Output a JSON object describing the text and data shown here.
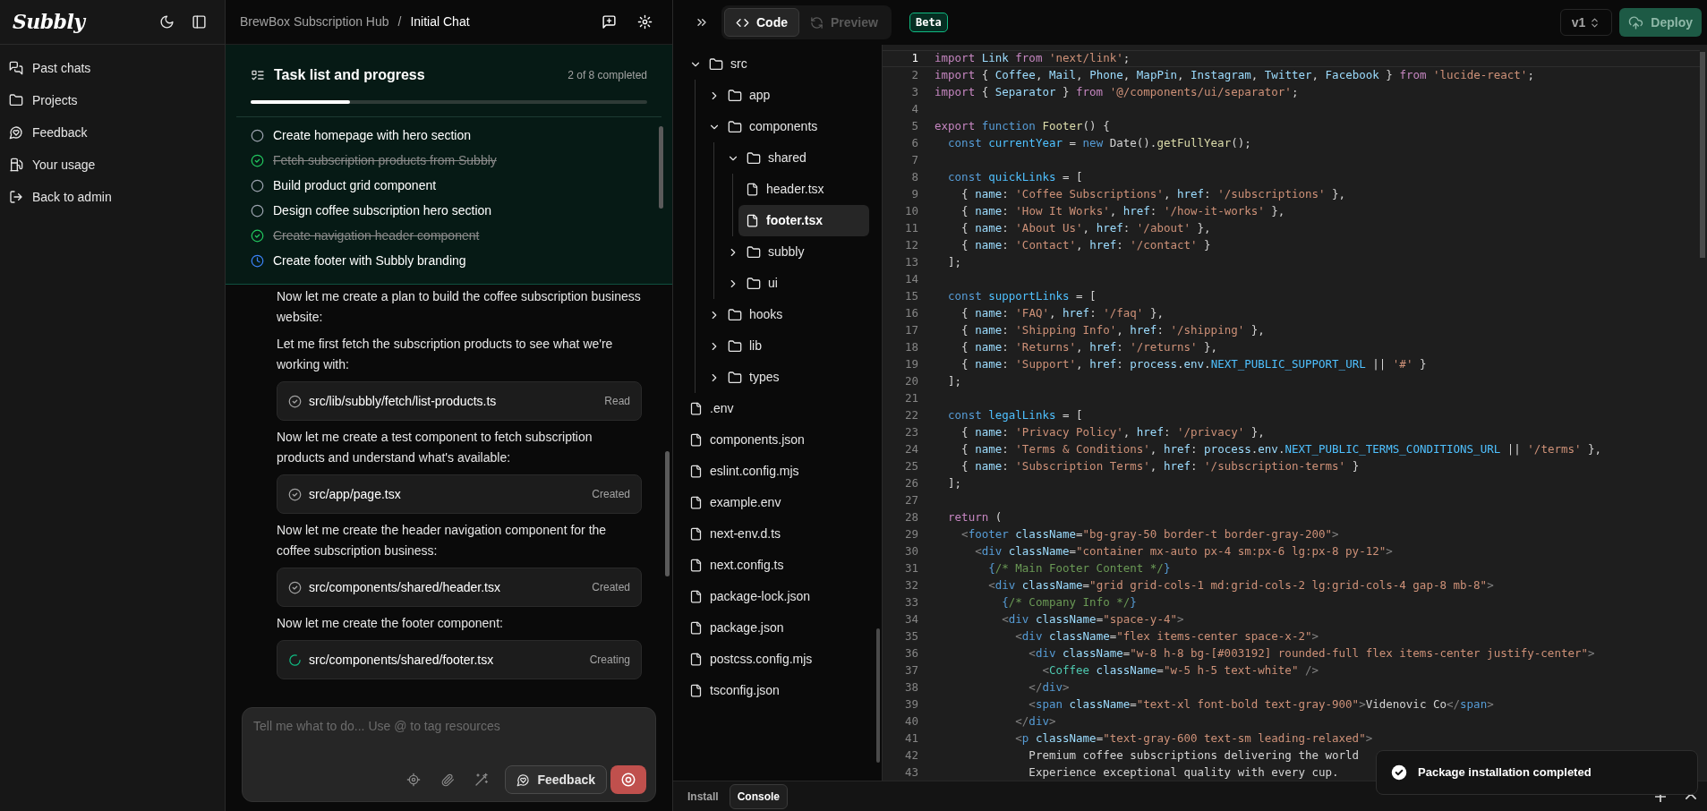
{
  "sidebar": {
    "logo": "Subbly",
    "items": [
      {
        "label": "Past chats"
      },
      {
        "label": "Projects"
      },
      {
        "label": "Feedback"
      },
      {
        "label": "Your usage"
      },
      {
        "label": "Back to admin"
      }
    ]
  },
  "chat": {
    "breadcrumb": {
      "project": "BrewBox Subscription Hub",
      "separator": "/",
      "chat": "Initial Chat"
    },
    "tasks": {
      "title": "Task list and progress",
      "count": "2 of 8 completed",
      "level": 0.25,
      "items": [
        {
          "label": "Create homepage with hero section",
          "checked": false,
          "in_progress": false
        },
        {
          "label": "Fetch subscription products from Subbly",
          "checked": true,
          "in_progress": false
        },
        {
          "label": "Build product grid component",
          "checked": false,
          "in_progress": false
        },
        {
          "label": "Design coffee subscription hero section",
          "checked": false,
          "in_progress": false
        },
        {
          "label": "Create navigation header component",
          "checked": true,
          "in_progress": false
        },
        {
          "label": "Create footer with Subbly branding",
          "checked": false,
          "in_progress": true
        }
      ]
    },
    "messages": [
      {
        "kind": "text",
        "text": "Now let me create a plan to build the coffee subscription business website:"
      },
      {
        "kind": "text",
        "text": "Let me first fetch the subscription products to see what we're working with:"
      },
      {
        "kind": "file",
        "path": "src/lib/subbly/fetch/list-products.ts",
        "status": "Read",
        "running": false
      },
      {
        "kind": "text",
        "text": "Now let me create a test component to fetch subscription products and understand what's available:"
      },
      {
        "kind": "file",
        "path": "src/app/page.tsx",
        "status": "Created",
        "running": false
      },
      {
        "kind": "text",
        "text": "Now let me create the header navigation component for the coffee subscription business:"
      },
      {
        "kind": "file",
        "path": "src/components/shared/header.tsx",
        "status": "Created",
        "running": false
      },
      {
        "kind": "text",
        "text": "Now let me create the footer component:"
      },
      {
        "kind": "file",
        "path": "src/components/shared/footer.tsx",
        "status": "Creating",
        "running": true
      }
    ],
    "input": {
      "placeholder": "Tell me what to do... Use @ to tag resources",
      "feedback": "Feedback"
    }
  },
  "toolbar": {
    "tabs": [
      {
        "label": "Code",
        "selected": true
      },
      {
        "label": "Preview",
        "selected": false
      }
    ],
    "badge": "Beta",
    "version": "v1",
    "deploy": "Deploy"
  },
  "file_tree": [
    {
      "name": "src",
      "kind": "folder",
      "expanded": true,
      "selected": false,
      "children": [
        {
          "name": "app",
          "kind": "folder",
          "expanded": false,
          "selected": false
        },
        {
          "name": "components",
          "kind": "folder",
          "expanded": true,
          "selected": false,
          "children": [
            {
              "name": "shared",
              "kind": "folder",
              "expanded": true,
              "selected": false,
              "children": [
                {
                  "name": "header.tsx",
                  "kind": "file",
                  "selected": false
                },
                {
                  "name": "footer.tsx",
                  "kind": "file",
                  "selected": true
                }
              ]
            },
            {
              "name": "subbly",
              "kind": "folder",
              "expanded": false,
              "selected": false
            },
            {
              "name": "ui",
              "kind": "folder",
              "expanded": false,
              "selected": false
            }
          ]
        },
        {
          "name": "hooks",
          "kind": "folder",
          "expanded": false,
          "selected": false
        },
        {
          "name": "lib",
          "kind": "folder",
          "expanded": false,
          "selected": false
        },
        {
          "name": "types",
          "kind": "folder",
          "expanded": false,
          "selected": false
        }
      ]
    },
    {
      "name": ".env",
      "kind": "file",
      "selected": false
    },
    {
      "name": "components.json",
      "kind": "file",
      "selected": false
    },
    {
      "name": "eslint.config.mjs",
      "kind": "file",
      "selected": false
    },
    {
      "name": "example.env",
      "kind": "file",
      "selected": false
    },
    {
      "name": "next-env.d.ts",
      "kind": "file",
      "selected": false
    },
    {
      "name": "next.config.ts",
      "kind": "file",
      "selected": false
    },
    {
      "name": "package-lock.json",
      "kind": "file",
      "selected": false
    },
    {
      "name": "package.json",
      "kind": "file",
      "selected": false
    },
    {
      "name": "postcss.config.mjs",
      "kind": "file",
      "selected": false
    },
    {
      "name": "tsconfig.json",
      "kind": "file",
      "selected": false
    }
  ],
  "editor": {
    "lines": [
      {
        "number": "1",
        "current": true,
        "segments": [
          {
            "kind": "keyword",
            "text": "import"
          },
          {
            "kind": "variable",
            "text": " Link"
          },
          {
            "kind": "keyword",
            "text": " from"
          },
          {
            "kind": "string",
            "text": " 'next/link'"
          },
          {
            "kind": "plain",
            "text": ";"
          }
        ]
      },
      {
        "number": "2",
        "current": false,
        "segments": [
          {
            "kind": "keyword",
            "text": "import"
          },
          {
            "kind": "plain",
            "text": " { "
          },
          {
            "kind": "variable",
            "text": "Coffee"
          },
          {
            "kind": "plain",
            "text": ", "
          },
          {
            "kind": "variable",
            "text": "Mail"
          },
          {
            "kind": "plain",
            "text": ", "
          },
          {
            "kind": "variable",
            "text": "Phone"
          },
          {
            "kind": "plain",
            "text": ", "
          },
          {
            "kind": "variable",
            "text": "MapPin"
          },
          {
            "kind": "plain",
            "text": ", "
          },
          {
            "kind": "variable",
            "text": "Instagram"
          },
          {
            "kind": "plain",
            "text": ", "
          },
          {
            "kind": "variable",
            "text": "Twitter"
          },
          {
            "kind": "plain",
            "text": ", "
          },
          {
            "kind": "variable",
            "text": "Facebook"
          },
          {
            "kind": "plain",
            "text": " } "
          },
          {
            "kind": "keyword",
            "text": "from"
          },
          {
            "kind": "string",
            "text": " 'lucide-react'"
          },
          {
            "kind": "plain",
            "text": ";"
          }
        ]
      },
      {
        "number": "3",
        "current": false,
        "segments": [
          {
            "kind": "keyword",
            "text": "import"
          },
          {
            "kind": "plain",
            "text": " { "
          },
          {
            "kind": "variable",
            "text": "Separator"
          },
          {
            "kind": "plain",
            "text": " } "
          },
          {
            "kind": "keyword",
            "text": "from"
          },
          {
            "kind": "string",
            "text": " '@/components/ui/separator'"
          },
          {
            "kind": "plain",
            "text": ";"
          }
        ]
      },
      {
        "number": "4",
        "current": false
      },
      {
        "number": "5",
        "current": false,
        "segments": [
          {
            "kind": "keyword",
            "text": "export"
          },
          {
            "kind": "storage",
            "text": " function"
          },
          {
            "kind": "function",
            "text": " Footer"
          },
          {
            "kind": "plain",
            "text": "() {"
          }
        ]
      },
      {
        "number": "6",
        "current": false,
        "segments": [
          {
            "kind": "storage",
            "text": "  const"
          },
          {
            "kind": "constant",
            "text": " currentYear"
          },
          {
            "kind": "plain",
            "text": " = "
          },
          {
            "kind": "storage",
            "text": "new"
          },
          {
            "kind": "plain",
            "text": " Date()."
          },
          {
            "kind": "function",
            "text": "getFullYear"
          },
          {
            "kind": "plain",
            "text": "();"
          }
        ]
      },
      {
        "number": "7",
        "current": false
      },
      {
        "number": "8",
        "current": false,
        "segments": [
          {
            "kind": "storage",
            "text": "  const"
          },
          {
            "kind": "constant",
            "text": " quickLinks"
          },
          {
            "kind": "plain",
            "text": " = ["
          }
        ]
      },
      {
        "number": "9",
        "current": false,
        "segments": [
          {
            "kind": "plain",
            "text": "    { "
          },
          {
            "kind": "variable",
            "text": "name"
          },
          {
            "kind": "plain",
            "text": ": "
          },
          {
            "kind": "string",
            "text": "'Coffee Subscriptions'"
          },
          {
            "kind": "plain",
            "text": ", "
          },
          {
            "kind": "variable",
            "text": "href"
          },
          {
            "kind": "plain",
            "text": ": "
          },
          {
            "kind": "string",
            "text": "'/subscriptions'"
          },
          {
            "kind": "plain",
            "text": " },"
          }
        ]
      },
      {
        "number": "10",
        "current": false,
        "segments": [
          {
            "kind": "plain",
            "text": "    { "
          },
          {
            "kind": "variable",
            "text": "name"
          },
          {
            "kind": "plain",
            "text": ": "
          },
          {
            "kind": "string",
            "text": "'How It Works'"
          },
          {
            "kind": "plain",
            "text": ", "
          },
          {
            "kind": "variable",
            "text": "href"
          },
          {
            "kind": "plain",
            "text": ": "
          },
          {
            "kind": "string",
            "text": "'/how-it-works'"
          },
          {
            "kind": "plain",
            "text": " },"
          }
        ]
      },
      {
        "number": "11",
        "current": false,
        "segments": [
          {
            "kind": "plain",
            "text": "    { "
          },
          {
            "kind": "variable",
            "text": "name"
          },
          {
            "kind": "plain",
            "text": ": "
          },
          {
            "kind": "string",
            "text": "'About Us'"
          },
          {
            "kind": "plain",
            "text": ", "
          },
          {
            "kind": "variable",
            "text": "href"
          },
          {
            "kind": "plain",
            "text": ": "
          },
          {
            "kind": "string",
            "text": "'/about'"
          },
          {
            "kind": "plain",
            "text": " },"
          }
        ]
      },
      {
        "number": "12",
        "current": false,
        "segments": [
          {
            "kind": "plain",
            "text": "    { "
          },
          {
            "kind": "variable",
            "text": "name"
          },
          {
            "kind": "plain",
            "text": ": "
          },
          {
            "kind": "string",
            "text": "'Contact'"
          },
          {
            "kind": "plain",
            "text": ", "
          },
          {
            "kind": "variable",
            "text": "href"
          },
          {
            "kind": "plain",
            "text": ": "
          },
          {
            "kind": "string",
            "text": "'/contact'"
          },
          {
            "kind": "plain",
            "text": " }"
          }
        ]
      },
      {
        "number": "13",
        "current": false,
        "segments": [
          {
            "kind": "plain",
            "text": "  ];"
          }
        ]
      },
      {
        "number": "14",
        "current": false
      },
      {
        "number": "15",
        "current": false,
        "segments": [
          {
            "kind": "storage",
            "text": "  const"
          },
          {
            "kind": "constant",
            "text": " supportLinks"
          },
          {
            "kind": "plain",
            "text": " = ["
          }
        ]
      },
      {
        "number": "16",
        "current": false,
        "segments": [
          {
            "kind": "plain",
            "text": "    { "
          },
          {
            "kind": "variable",
            "text": "name"
          },
          {
            "kind": "plain",
            "text": ": "
          },
          {
            "kind": "string",
            "text": "'FAQ'"
          },
          {
            "kind": "plain",
            "text": ", "
          },
          {
            "kind": "variable",
            "text": "href"
          },
          {
            "kind": "plain",
            "text": ": "
          },
          {
            "kind": "string",
            "text": "'/faq'"
          },
          {
            "kind": "plain",
            "text": " },"
          }
        ]
      },
      {
        "number": "17",
        "current": false,
        "segments": [
          {
            "kind": "plain",
            "text": "    { "
          },
          {
            "kind": "variable",
            "text": "name"
          },
          {
            "kind": "plain",
            "text": ": "
          },
          {
            "kind": "string",
            "text": "'Shipping Info'"
          },
          {
            "kind": "plain",
            "text": ", "
          },
          {
            "kind": "variable",
            "text": "href"
          },
          {
            "kind": "plain",
            "text": ": "
          },
          {
            "kind": "string",
            "text": "'/shipping'"
          },
          {
            "kind": "plain",
            "text": " },"
          }
        ]
      },
      {
        "number": "18",
        "current": false,
        "segments": [
          {
            "kind": "plain",
            "text": "    { "
          },
          {
            "kind": "variable",
            "text": "name"
          },
          {
            "kind": "plain",
            "text": ": "
          },
          {
            "kind": "string",
            "text": "'Returns'"
          },
          {
            "kind": "plain",
            "text": ", "
          },
          {
            "kind": "variable",
            "text": "href"
          },
          {
            "kind": "plain",
            "text": ": "
          },
          {
            "kind": "string",
            "text": "'/returns'"
          },
          {
            "kind": "plain",
            "text": " },"
          }
        ]
      },
      {
        "number": "19",
        "current": false,
        "segments": [
          {
            "kind": "plain",
            "text": "    { "
          },
          {
            "kind": "variable",
            "text": "name"
          },
          {
            "kind": "plain",
            "text": ": "
          },
          {
            "kind": "string",
            "text": "'Support'"
          },
          {
            "kind": "plain",
            "text": ", "
          },
          {
            "kind": "variable",
            "text": "href"
          },
          {
            "kind": "plain",
            "text": ": "
          },
          {
            "kind": "variable",
            "text": "process"
          },
          {
            "kind": "plain",
            "text": "."
          },
          {
            "kind": "variable",
            "text": "env"
          },
          {
            "kind": "plain",
            "text": "."
          },
          {
            "kind": "constant",
            "text": "NEXT_PUBLIC_SUPPORT_URL"
          },
          {
            "kind": "plain",
            "text": " || "
          },
          {
            "kind": "string",
            "text": "'#'"
          },
          {
            "kind": "plain",
            "text": " }"
          }
        ]
      },
      {
        "number": "20",
        "current": false,
        "segments": [
          {
            "kind": "plain",
            "text": "  ];"
          }
        ]
      },
      {
        "number": "21",
        "current": false
      },
      {
        "number": "22",
        "current": false,
        "segments": [
          {
            "kind": "storage",
            "text": "  const"
          },
          {
            "kind": "constant",
            "text": " legalLinks"
          },
          {
            "kind": "plain",
            "text": " = ["
          }
        ]
      },
      {
        "number": "23",
        "current": false,
        "segments": [
          {
            "kind": "plain",
            "text": "    { "
          },
          {
            "kind": "variable",
            "text": "name"
          },
          {
            "kind": "plain",
            "text": ": "
          },
          {
            "kind": "string",
            "text": "'Privacy Policy'"
          },
          {
            "kind": "plain",
            "text": ", "
          },
          {
            "kind": "variable",
            "text": "href"
          },
          {
            "kind": "plain",
            "text": ": "
          },
          {
            "kind": "string",
            "text": "'/privacy'"
          },
          {
            "kind": "plain",
            "text": " },"
          }
        ]
      },
      {
        "number": "24",
        "current": false,
        "segments": [
          {
            "kind": "plain",
            "text": "    { "
          },
          {
            "kind": "variable",
            "text": "name"
          },
          {
            "kind": "plain",
            "text": ": "
          },
          {
            "kind": "string",
            "text": "'Terms & Conditions'"
          },
          {
            "kind": "plain",
            "text": ", "
          },
          {
            "kind": "variable",
            "text": "href"
          },
          {
            "kind": "plain",
            "text": ": "
          },
          {
            "kind": "variable",
            "text": "process"
          },
          {
            "kind": "plain",
            "text": "."
          },
          {
            "kind": "variable",
            "text": "env"
          },
          {
            "kind": "plain",
            "text": "."
          },
          {
            "kind": "constant",
            "text": "NEXT_PUBLIC_TERMS_CONDITIONS_URL"
          },
          {
            "kind": "plain",
            "text": " || "
          },
          {
            "kind": "string",
            "text": "'/terms'"
          },
          {
            "kind": "plain",
            "text": " },"
          }
        ]
      },
      {
        "number": "25",
        "current": false,
        "segments": [
          {
            "kind": "plain",
            "text": "    { "
          },
          {
            "kind": "variable",
            "text": "name"
          },
          {
            "kind": "plain",
            "text": ": "
          },
          {
            "kind": "string",
            "text": "'Subscription Terms'"
          },
          {
            "kind": "plain",
            "text": ", "
          },
          {
            "kind": "variable",
            "text": "href"
          },
          {
            "kind": "plain",
            "text": ": "
          },
          {
            "kind": "string",
            "text": "'/subscription-terms'"
          },
          {
            "kind": "plain",
            "text": " }"
          }
        ]
      },
      {
        "number": "26",
        "current": false,
        "segments": [
          {
            "kind": "plain",
            "text": "  ];"
          }
        ]
      },
      {
        "number": "27",
        "current": false
      },
      {
        "number": "28",
        "current": false,
        "segments": [
          {
            "kind": "keyword",
            "text": "  return"
          },
          {
            "kind": "plain",
            "text": " ("
          }
        ]
      },
      {
        "number": "29",
        "current": false,
        "segments": [
          {
            "kind": "punctuation",
            "text": "    <"
          },
          {
            "kind": "tag",
            "text": "footer"
          },
          {
            "kind": "variable",
            "text": " className"
          },
          {
            "kind": "plain",
            "text": "="
          },
          {
            "kind": "string",
            "text": "\"bg-gray-50 border-t border-gray-200\""
          },
          {
            "kind": "punctuation",
            "text": ">"
          }
        ]
      },
      {
        "number": "30",
        "current": false,
        "segments": [
          {
            "kind": "punctuation",
            "text": "      <"
          },
          {
            "kind": "tag",
            "text": "div"
          },
          {
            "kind": "variable",
            "text": " className"
          },
          {
            "kind": "plain",
            "text": "="
          },
          {
            "kind": "string",
            "text": "\"container mx-auto px-4 sm:px-6 lg:px-8 py-12\""
          },
          {
            "kind": "punctuation",
            "text": ">"
          }
        ]
      },
      {
        "number": "31",
        "current": false,
        "segments": [
          {
            "kind": "tag",
            "text": "        {"
          },
          {
            "kind": "comment",
            "text": "/* Main Footer Content */"
          },
          {
            "kind": "tag",
            "text": "}"
          }
        ]
      },
      {
        "number": "32",
        "current": false,
        "segments": [
          {
            "kind": "punctuation",
            "text": "        <"
          },
          {
            "kind": "tag",
            "text": "div"
          },
          {
            "kind": "variable",
            "text": " className"
          },
          {
            "kind": "plain",
            "text": "="
          },
          {
            "kind": "string",
            "text": "\"grid grid-cols-1 md:grid-cols-2 lg:grid-cols-4 gap-8 mb-8\""
          },
          {
            "kind": "punctuation",
            "text": ">"
          }
        ]
      },
      {
        "number": "33",
        "current": false,
        "segments": [
          {
            "kind": "tag",
            "text": "          {"
          },
          {
            "kind": "comment",
            "text": "/* Company Info */"
          },
          {
            "kind": "tag",
            "text": "}"
          }
        ]
      },
      {
        "number": "34",
        "current": false,
        "segments": [
          {
            "kind": "punctuation",
            "text": "          <"
          },
          {
            "kind": "tag",
            "text": "div"
          },
          {
            "kind": "variable",
            "text": " className"
          },
          {
            "kind": "plain",
            "text": "="
          },
          {
            "kind": "string",
            "text": "\"space-y-4\""
          },
          {
            "kind": "punctuation",
            "text": ">"
          }
        ]
      },
      {
        "number": "35",
        "current": false,
        "segments": [
          {
            "kind": "punctuation",
            "text": "            <"
          },
          {
            "kind": "tag",
            "text": "div"
          },
          {
            "kind": "variable",
            "text": " className"
          },
          {
            "kind": "plain",
            "text": "="
          },
          {
            "kind": "string",
            "text": "\"flex items-center space-x-2\""
          },
          {
            "kind": "punctuation",
            "text": ">"
          }
        ]
      },
      {
        "number": "36",
        "current": false,
        "segments": [
          {
            "kind": "punctuation",
            "text": "              <"
          },
          {
            "kind": "tag",
            "text": "div"
          },
          {
            "kind": "variable",
            "text": " className"
          },
          {
            "kind": "plain",
            "text": "="
          },
          {
            "kind": "string",
            "text": "\"w-8 h-8 bg-[#003192] rounded-full flex items-center justify-center\""
          },
          {
            "kind": "punctuation",
            "text": ">"
          }
        ]
      },
      {
        "number": "37",
        "current": false,
        "segments": [
          {
            "kind": "punctuation",
            "text": "                <"
          },
          {
            "kind": "component",
            "text": "Coffee"
          },
          {
            "kind": "variable",
            "text": " className"
          },
          {
            "kind": "plain",
            "text": "="
          },
          {
            "kind": "string",
            "text": "\"w-5 h-5 text-white\""
          },
          {
            "kind": "punctuation",
            "text": " />"
          }
        ]
      },
      {
        "number": "38",
        "current": false,
        "segments": [
          {
            "kind": "punctuation",
            "text": "              </"
          },
          {
            "kind": "tag",
            "text": "div"
          },
          {
            "kind": "punctuation",
            "text": ">"
          }
        ]
      },
      {
        "number": "39",
        "current": false,
        "segments": [
          {
            "kind": "punctuation",
            "text": "              <"
          },
          {
            "kind": "tag",
            "text": "span"
          },
          {
            "kind": "variable",
            "text": " className"
          },
          {
            "kind": "plain",
            "text": "="
          },
          {
            "kind": "string",
            "text": "\"text-xl font-bold text-gray-900\""
          },
          {
            "kind": "punctuation",
            "text": ">"
          },
          {
            "kind": "plain",
            "text": "Videnovic Co"
          },
          {
            "kind": "punctuation",
            "text": "</"
          },
          {
            "kind": "tag",
            "text": "span"
          },
          {
            "kind": "punctuation",
            "text": ">"
          }
        ]
      },
      {
        "number": "40",
        "current": false,
        "segments": [
          {
            "kind": "punctuation",
            "text": "            </"
          },
          {
            "kind": "tag",
            "text": "div"
          },
          {
            "kind": "punctuation",
            "text": ">"
          }
        ]
      },
      {
        "number": "41",
        "current": false,
        "segments": [
          {
            "kind": "punctuation",
            "text": "            <"
          },
          {
            "kind": "tag",
            "text": "p"
          },
          {
            "kind": "variable",
            "text": " className"
          },
          {
            "kind": "plain",
            "text": "="
          },
          {
            "kind": "string",
            "text": "\"text-gray-600 text-sm leading-relaxed\""
          },
          {
            "kind": "punctuation",
            "text": ">"
          }
        ]
      },
      {
        "number": "42",
        "current": false,
        "segments": [
          {
            "kind": "plain",
            "text": "              Premium coffee subscriptions delivering the world"
          }
        ]
      },
      {
        "number": "43",
        "current": false,
        "segments": [
          {
            "kind": "plain",
            "text": "              Experience exceptional quality with every cup."
          }
        ]
      }
    ]
  },
  "bottom_tabs": [
    {
      "label": "Install",
      "selected": false
    },
    {
      "label": "Console",
      "selected": true
    }
  ],
  "toast": {
    "message": "Package installation completed"
  }
}
